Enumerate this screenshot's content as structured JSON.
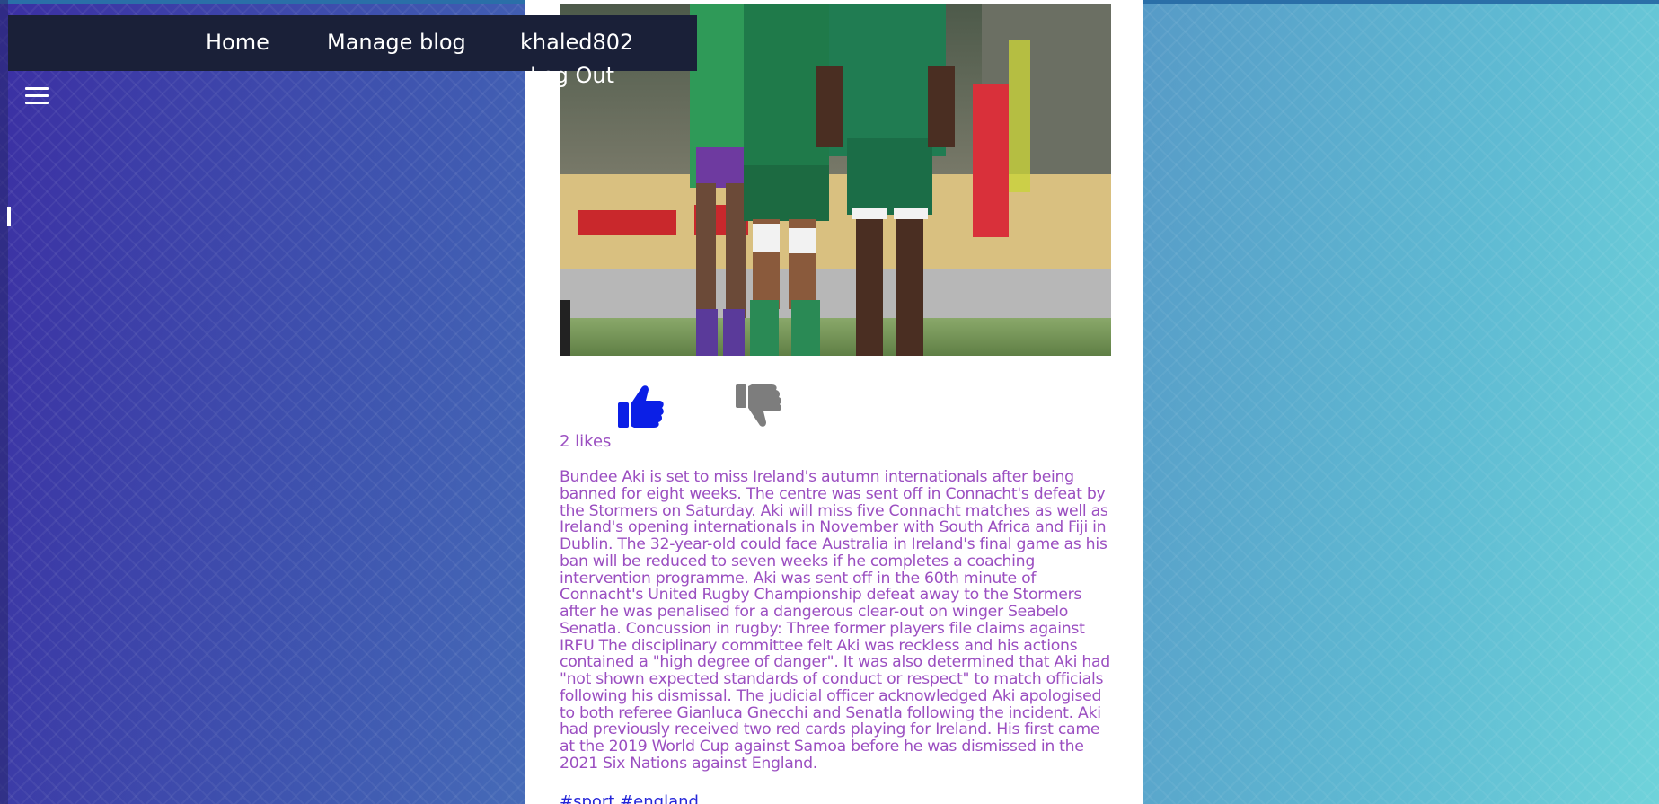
{
  "nav": {
    "home_label": "Home",
    "manage_label": "Manage blog",
    "user_label": "khaled802",
    "logout_label": "Log Out"
  },
  "icons": {
    "menu": "hamburger-menu-icon",
    "like": "thumbs-up-icon",
    "dislike": "thumbs-down-icon"
  },
  "post": {
    "image_alt": "Connacht rugby players on the pitch",
    "likes_text": "2 likes",
    "body": "Bundee Aki is set to miss Ireland's autumn internationals after being banned for eight weeks. The centre was sent off in Connacht's defeat by the Stormers on Saturday. Aki will miss five Connacht matches as well as Ireland's opening internationals in November with South Africa and Fiji in Dublin. The 32-year-old could face Australia in Ireland's final game as his ban will be reduced to seven weeks if he completes a coaching intervention programme. Aki was sent off in the 60th minute of Connacht's United Rugby Championship defeat away to the Stormers after he was penalised for a dangerous clear-out on winger Seabelo Senatla. Concussion in rugby: Three former players file claims against IRFU The disciplinary committee felt Aki was reckless and his actions contained a \"high degree of danger\". It was also determined that Aki had \"not shown expected standards of conduct or respect\" to match officials following his dismissal. The judicial officer acknowledged Aki apologised to both referee Gianluca Gnecchi and Senatla following the incident. Aki had previously received two red cards playing for Ireland. His first came at the 2019 World Cup against Samoa before he was dismissed in the 2021 Six Nations against England.",
    "tags": [
      "#sport",
      "#england"
    ]
  },
  "colors": {
    "navbar_bg": "#1a2038",
    "text_purple": "#9b4fc1",
    "like_blue": "#0b1fe6",
    "dislike_gray": "#7d7d7d",
    "tag_blue": "#2525d8"
  }
}
